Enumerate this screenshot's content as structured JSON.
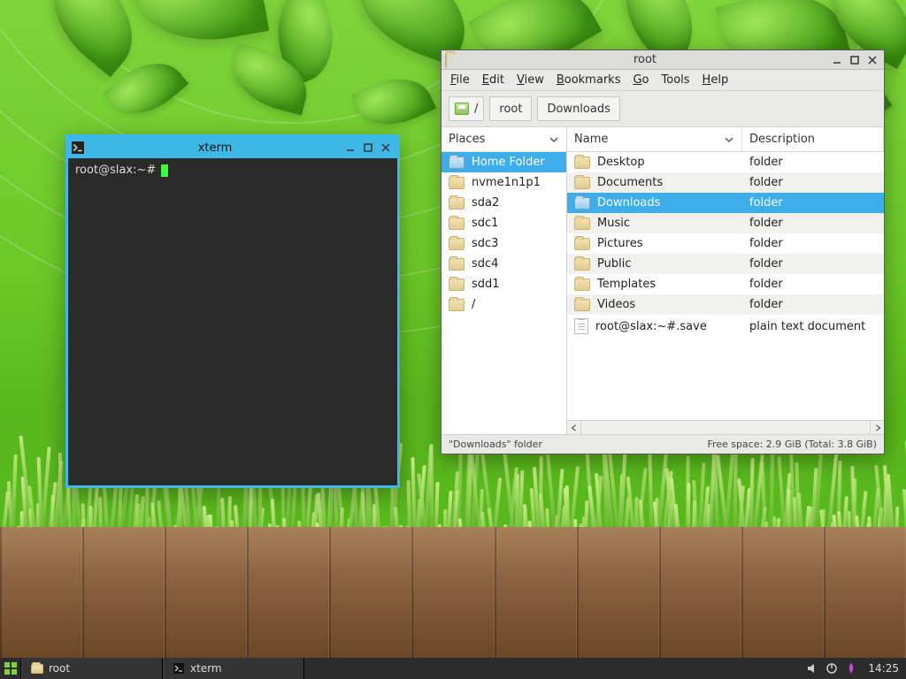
{
  "xterm": {
    "title": "xterm",
    "prompt": "root@slax:~# "
  },
  "fm": {
    "title": "root",
    "menu": {
      "file": "File",
      "edit": "Edit",
      "view": "View",
      "bookmarks": "Bookmarks",
      "go": "Go",
      "tools": "Tools",
      "help": "Help"
    },
    "path": {
      "root": "/",
      "seg1": "root",
      "seg2": "Downloads"
    },
    "sidebar": {
      "header": "Places",
      "items": [
        "Home Folder",
        "nvme1n1p1",
        "sda2",
        "sdc1",
        "sdc3",
        "sdc4",
        "sdd1",
        "/"
      ],
      "selected": 0
    },
    "columns": {
      "name": "Name",
      "desc": "Description"
    },
    "rows": [
      {
        "name": "Desktop",
        "desc": "folder",
        "type": "folder"
      },
      {
        "name": "Documents",
        "desc": "folder",
        "type": "folder"
      },
      {
        "name": "Downloads",
        "desc": "folder",
        "type": "folder",
        "selected": true
      },
      {
        "name": "Music",
        "desc": "folder",
        "type": "folder"
      },
      {
        "name": "Pictures",
        "desc": "folder",
        "type": "folder"
      },
      {
        "name": "Public",
        "desc": "folder",
        "type": "folder"
      },
      {
        "name": "Templates",
        "desc": "folder",
        "type": "folder"
      },
      {
        "name": "Videos",
        "desc": "folder",
        "type": "folder"
      },
      {
        "name": "root@slax:~#.save",
        "desc": "plain text document",
        "type": "file"
      }
    ],
    "status": {
      "left": "\"Downloads\" folder",
      "right": "Free space: 2.9 GiB (Total: 3.8 GiB)"
    }
  },
  "taskbar": {
    "tasks": [
      {
        "label": "root",
        "icon": "folder"
      },
      {
        "label": "xterm",
        "icon": "terminal"
      }
    ],
    "clock": "14:25"
  }
}
